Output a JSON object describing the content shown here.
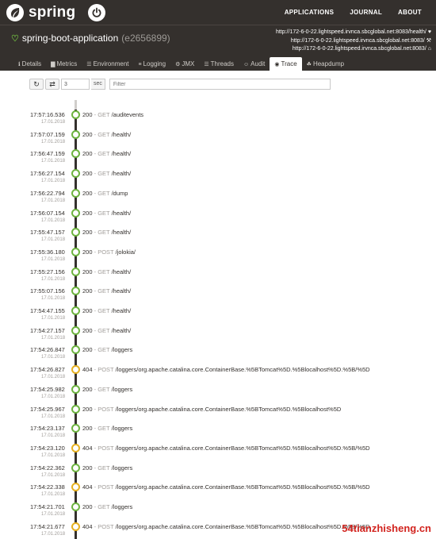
{
  "header": {
    "brand": "spring",
    "nav": [
      "APPLICATIONS",
      "JOURNAL",
      "ABOUT"
    ]
  },
  "app": {
    "status_icon": "heartbeat-icon",
    "name": "spring-boot-application",
    "id": "(e2656899)",
    "urls": [
      {
        "text": "http://172-6-0-22.lightspeed.irvnca.sbcglobal.net:8083/health/",
        "icon": "heart-icon"
      },
      {
        "text": "http://172-6-0-22.lightspeed.irvnca.sbcglobal.net:8083/",
        "icon": "wrench-icon"
      },
      {
        "text": "http://172-6-0-22.lightspeed.irvnca.sbcglobal.net:8083/",
        "icon": "home-icon"
      }
    ]
  },
  "tabs": [
    {
      "label": "Details",
      "icon": "info-icon"
    },
    {
      "label": "Metrics",
      "icon": "bar-chart-icon"
    },
    {
      "label": "Environment",
      "icon": "list-icon"
    },
    {
      "label": "Logging",
      "icon": "sliders-icon"
    },
    {
      "label": "JMX",
      "icon": "cogs-icon"
    },
    {
      "label": "Threads",
      "icon": "threads-icon"
    },
    {
      "label": "Audit",
      "icon": "user-icon"
    },
    {
      "label": "Trace",
      "icon": "eye-icon",
      "active": true
    },
    {
      "label": "Heapdump",
      "icon": "heapdump-icon"
    }
  ],
  "toolbar": {
    "interval_value": "3",
    "interval_unit": "sec",
    "filter_placeholder": "Filter"
  },
  "traces": [
    {
      "time": "17:57:16.536",
      "date": "17.01.2018",
      "status": "200",
      "method": "GET",
      "path": "/auditevents"
    },
    {
      "time": "17:57:07.159",
      "date": "17.01.2018",
      "status": "200",
      "method": "GET",
      "path": "/health/"
    },
    {
      "time": "17:56:47.159",
      "date": "17.01.2018",
      "status": "200",
      "method": "GET",
      "path": "/health/"
    },
    {
      "time": "17:56:27.154",
      "date": "17.01.2018",
      "status": "200",
      "method": "GET",
      "path": "/health/"
    },
    {
      "time": "17:56:22.794",
      "date": "17.01.2018",
      "status": "200",
      "method": "GET",
      "path": "/dump"
    },
    {
      "time": "17:56:07.154",
      "date": "17.01.2018",
      "status": "200",
      "method": "GET",
      "path": "/health/"
    },
    {
      "time": "17:55:47.157",
      "date": "17.01.2018",
      "status": "200",
      "method": "GET",
      "path": "/health/"
    },
    {
      "time": "17:55:36.180",
      "date": "17.01.2018",
      "status": "200",
      "method": "POST",
      "path": "/jolokia/"
    },
    {
      "time": "17:55:27.156",
      "date": "17.01.2018",
      "status": "200",
      "method": "GET",
      "path": "/health/"
    },
    {
      "time": "17:55:07.156",
      "date": "17.01.2018",
      "status": "200",
      "method": "GET",
      "path": "/health/"
    },
    {
      "time": "17:54:47.155",
      "date": "17.01.2018",
      "status": "200",
      "method": "GET",
      "path": "/health/"
    },
    {
      "time": "17:54:27.157",
      "date": "17.01.2018",
      "status": "200",
      "method": "GET",
      "path": "/health/"
    },
    {
      "time": "17:54:26.847",
      "date": "17.01.2018",
      "status": "200",
      "method": "GET",
      "path": "/loggers"
    },
    {
      "time": "17:54:26.827",
      "date": "17.01.2018",
      "status": "404",
      "method": "POST",
      "path": "/loggers/org.apache.catalina.core.ContainerBase.%5BTomcat%5D.%5Blocalhost%5D.%5B/%5D"
    },
    {
      "time": "17:54:25.982",
      "date": "17.01.2018",
      "status": "200",
      "method": "GET",
      "path": "/loggers"
    },
    {
      "time": "17:54:25.967",
      "date": "17.01.2018",
      "status": "200",
      "method": "POST",
      "path": "/loggers/org.apache.catalina.core.ContainerBase.%5BTomcat%5D.%5Blocalhost%5D"
    },
    {
      "time": "17:54:23.137",
      "date": "17.01.2018",
      "status": "200",
      "method": "GET",
      "path": "/loggers"
    },
    {
      "time": "17:54:23.120",
      "date": "17.01.2018",
      "status": "404",
      "method": "POST",
      "path": "/loggers/org.apache.catalina.core.ContainerBase.%5BTomcat%5D.%5Blocalhost%5D.%5B/%5D"
    },
    {
      "time": "17:54:22.362",
      "date": "17.01.2018",
      "status": "200",
      "method": "GET",
      "path": "/loggers"
    },
    {
      "time": "17:54:22.338",
      "date": "17.01.2018",
      "status": "404",
      "method": "POST",
      "path": "/loggers/org.apache.catalina.core.ContainerBase.%5BTomcat%5D.%5Blocalhost%5D.%5B/%5D"
    },
    {
      "time": "17:54:21.701",
      "date": "17.01.2018",
      "status": "200",
      "method": "GET",
      "path": "/loggers"
    },
    {
      "time": "17:54:21.677",
      "date": "17.01.2018",
      "status": "404",
      "method": "POST",
      "path": "/loggers/org.apache.catalina.core.ContainerBase.%5BTomcat%5D.%5Blocalhost%5D.%5B/%5D"
    }
  ],
  "watermark": "54tianzhisheng.cn",
  "colors": {
    "brand_dark": "#34302d",
    "accent_green": "#6db33f",
    "warn_yellow": "#e6b020"
  }
}
